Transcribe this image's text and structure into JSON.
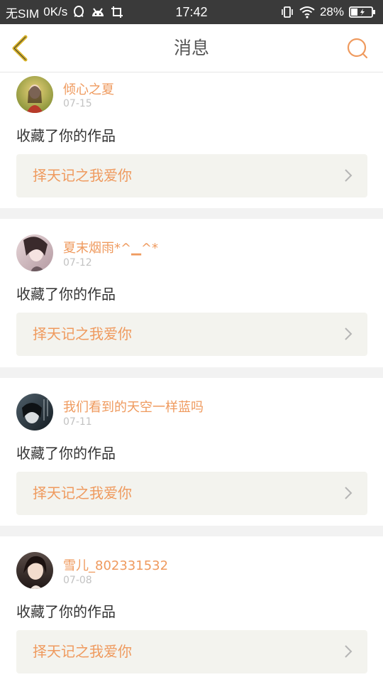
{
  "status_bar": {
    "carrier": "无SIM",
    "speed": "0K/s",
    "time": "17:42",
    "battery": "28%",
    "left_icons": [
      "qq-icon",
      "android-icon",
      "screenshot-icon"
    ],
    "right_icons": [
      "vibrate-icon",
      "wifi-icon",
      "battery-icon"
    ]
  },
  "header": {
    "title": "消息",
    "back_icon": "chevron-left-icon",
    "search_icon": "search-icon",
    "accent": "#ef9a5e",
    "back_color": "#d9b326"
  },
  "messages": [
    {
      "user": "倾心之夏",
      "date": "07-15",
      "action": "收藏了你的作品",
      "work": "择天记之我爱你"
    },
    {
      "user": "夏末烟雨*^▁^*",
      "date": "07-12",
      "action": "收藏了你的作品",
      "work": "择天记之我爱你"
    },
    {
      "user": "我们看到的天空一样蓝吗",
      "date": "07-11",
      "action": "收藏了你的作品",
      "work": "择天记之我爱你"
    },
    {
      "user": "雪儿_802331532",
      "date": "07-08",
      "action": "收藏了你的作品",
      "work": "择天记之我爱你"
    }
  ]
}
